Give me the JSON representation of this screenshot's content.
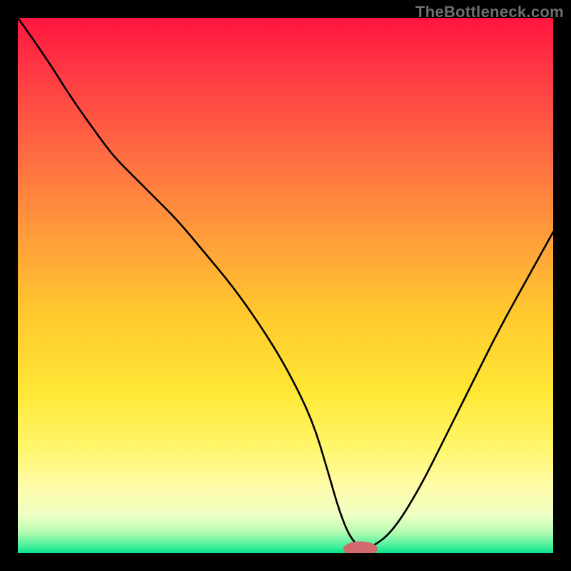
{
  "attribution": "TheBottleneck.com",
  "chart_data": {
    "type": "line",
    "title": "",
    "xlabel": "",
    "ylabel": "",
    "xlim": [
      0,
      100
    ],
    "ylim": [
      0,
      100
    ],
    "series": [
      {
        "name": "bottleneck-curve",
        "x": [
          0,
          5,
          10,
          15,
          18,
          22,
          26,
          30,
          35,
          40,
          45,
          50,
          55,
          58,
          60,
          62,
          64,
          66,
          70,
          75,
          80,
          85,
          90,
          95,
          100
        ],
        "y": [
          100,
          93,
          85,
          78,
          74,
          70,
          66,
          62,
          56,
          50,
          43,
          35,
          25,
          15,
          8,
          3,
          1,
          1,
          4,
          12,
          22,
          32,
          42,
          51,
          60
        ]
      }
    ],
    "marker": {
      "x": 64,
      "y": 0.8,
      "rx": 3.2,
      "ry": 1.4,
      "color": "#d16a6f"
    },
    "gradient_stops": [
      {
        "offset": 0.0,
        "color": "#ff153f"
      },
      {
        "offset": 0.1,
        "color": "#ff3844"
      },
      {
        "offset": 0.25,
        "color": "#ff6a42"
      },
      {
        "offset": 0.4,
        "color": "#ff9a3b"
      },
      {
        "offset": 0.55,
        "color": "#ffc82e"
      },
      {
        "offset": 0.7,
        "color": "#ffe735"
      },
      {
        "offset": 0.8,
        "color": "#fff66a"
      },
      {
        "offset": 0.88,
        "color": "#fffcac"
      },
      {
        "offset": 0.93,
        "color": "#ecffc4"
      },
      {
        "offset": 0.96,
        "color": "#b7fcb3"
      },
      {
        "offset": 0.985,
        "color": "#4ff19e"
      },
      {
        "offset": 1.0,
        "color": "#06e48d"
      }
    ]
  }
}
